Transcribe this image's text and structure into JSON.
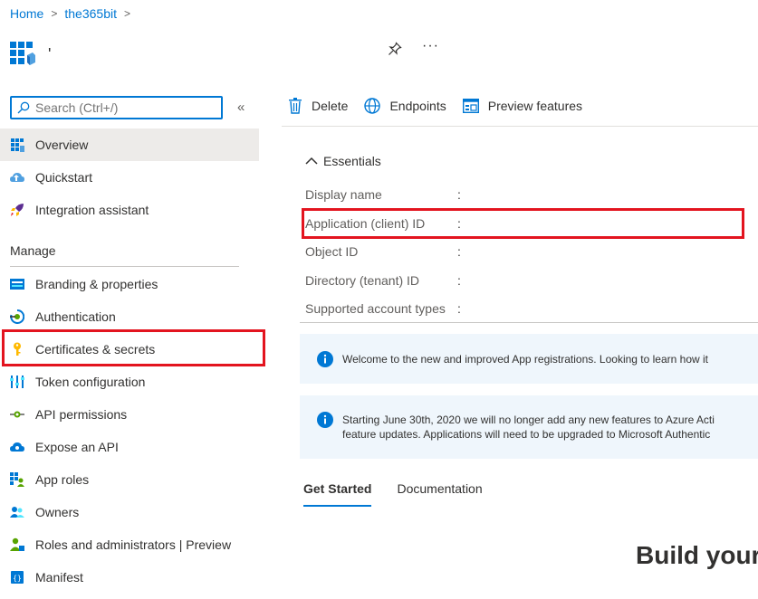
{
  "breadcrumb": {
    "home": "Home",
    "tenant": "the365bit"
  },
  "app": {
    "name": "'"
  },
  "header": {
    "more": "···"
  },
  "search": {
    "placeholder": "Search (Ctrl+/)",
    "collapse": "«"
  },
  "sidebar": {
    "items": [
      {
        "label": "Overview",
        "icon": "overview-icon"
      },
      {
        "label": "Quickstart",
        "icon": "quickstart-icon"
      },
      {
        "label": "Integration assistant",
        "icon": "rocket-icon"
      }
    ],
    "section_manage": "Manage",
    "manage_items": [
      {
        "label": "Branding & properties",
        "icon": "branding-icon"
      },
      {
        "label": "Authentication",
        "icon": "authentication-icon"
      },
      {
        "label": "Certificates & secrets",
        "icon": "key-icon"
      },
      {
        "label": "Token configuration",
        "icon": "token-icon"
      },
      {
        "label": "API permissions",
        "icon": "api-permissions-icon"
      },
      {
        "label": "Expose an API",
        "icon": "cloud-icon"
      },
      {
        "label": "App roles",
        "icon": "app-roles-icon"
      },
      {
        "label": "Owners",
        "icon": "owners-icon"
      },
      {
        "label": "Roles and administrators | Preview",
        "icon": "roles-icon"
      },
      {
        "label": "Manifest",
        "icon": "manifest-icon"
      }
    ]
  },
  "toolbar": {
    "delete": "Delete",
    "endpoints": "Endpoints",
    "preview": "Preview features"
  },
  "essentials": {
    "title": "Essentials",
    "colon": ":",
    "rows": [
      "Display name",
      "Application (client) ID",
      "Object ID",
      "Directory (tenant) ID",
      "Supported account types"
    ]
  },
  "banners": {
    "welcome": "Welcome to the new and improved App registrations. Looking to learn how it",
    "notice_line1": "Starting June 30th, 2020 we will no longer add any new features to Azure Acti",
    "notice_line2": "feature updates. Applications will need to be upgraded to Microsoft Authentic"
  },
  "tabs": {
    "get_started": "Get Started",
    "documentation": "Documentation"
  },
  "main": {
    "heading": "Build your"
  },
  "colors": {
    "accent": "#0078d4",
    "highlight": "#e3141f",
    "banner": "#eff6fc"
  }
}
